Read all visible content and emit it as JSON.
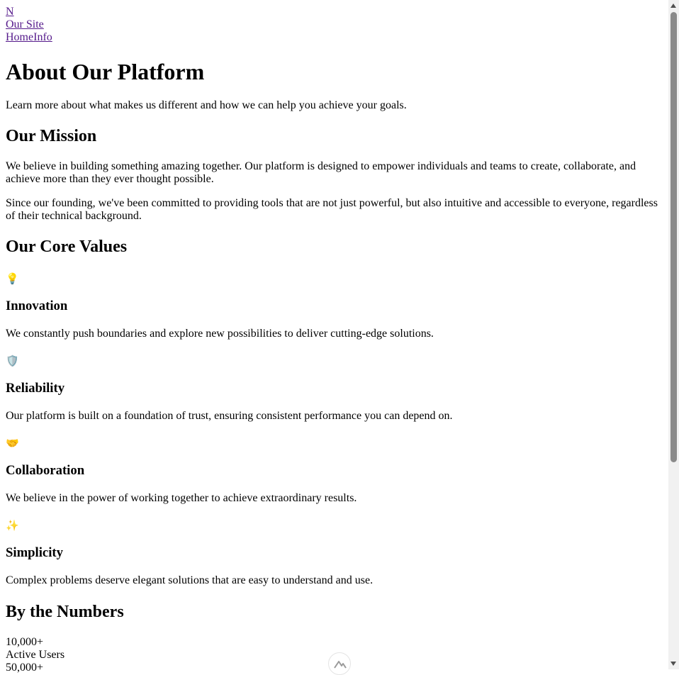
{
  "nav": {
    "logo_text": "N",
    "site_name": "Our Site",
    "links": [
      "Home",
      "Info"
    ]
  },
  "hero": {
    "title": "About Our Platform",
    "intro": "Learn more about what makes us different and how we can help you achieve your goals."
  },
  "mission": {
    "heading": "Our Mission",
    "paragraphs": [
      "We believe in building something amazing together. Our platform is designed to empower individuals and teams to create, collaborate, and achieve more than they ever thought possible.",
      "Since our founding, we've been committed to providing tools that are not just powerful, but also intuitive and accessible to everyone, regardless of their technical background."
    ]
  },
  "values": {
    "heading": "Our Core Values",
    "items": [
      {
        "icon": "lightbulb-icon",
        "glyph": "💡",
        "title": "Innovation",
        "description": "We constantly push boundaries and explore new possibilities to deliver cutting-edge solutions."
      },
      {
        "icon": "shield-icon",
        "glyph": "🛡️",
        "title": "Reliability",
        "description": "Our platform is built on a foundation of trust, ensuring consistent performance you can depend on."
      },
      {
        "icon": "handshake-icon",
        "glyph": "🤝",
        "title": "Collaboration",
        "description": "We believe in the power of working together to achieve extraordinary results."
      },
      {
        "icon": "sparkles-icon",
        "glyph": "✨",
        "title": "Simplicity",
        "description": "Complex problems deserve elegant solutions that are easy to understand and use."
      }
    ]
  },
  "numbers": {
    "heading": "By the Numbers",
    "stats": [
      {
        "value": "10,000+",
        "label": "Active Users"
      },
      {
        "value": "50,000+",
        "label": ""
      }
    ]
  }
}
